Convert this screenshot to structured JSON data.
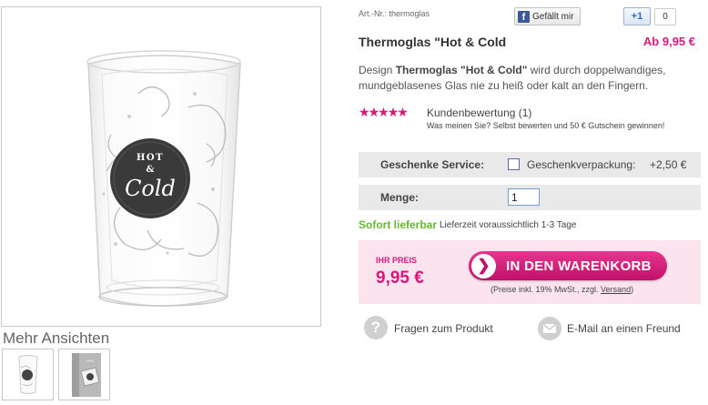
{
  "gallery": {
    "main_image": {
      "alt": "Thermoglas Hot & Cold",
      "badge_line1": "HOT",
      "badge_line2": "&",
      "badge_line3": "Cold"
    },
    "more_views_title": "Mehr Ansichten",
    "thumbnails": [
      "thumb-1",
      "thumb-2"
    ]
  },
  "product": {
    "art_nr": "Art.-Nr.: thermoglas",
    "title": "Thermoglas \"Hot & Cold",
    "price_from": "Ab 9,95 €",
    "description_prefix": "Design ",
    "description_bold": "Thermoglas \"Hot & Cold\"",
    "description_suffix": " wird durch doppelwandiges, mundgeblasenes Glas nie zu heiß oder kalt an den Fingern."
  },
  "social": {
    "fb_label": "Gefällt mir",
    "gplus_label": "+1",
    "gplus_count": "0"
  },
  "rating": {
    "stars": 5,
    "max": 5,
    "link": "Kundenbewertung (1)",
    "note": "Was meinen Sie? Selbst bewerten und 50 € Gutschein gewinnen!"
  },
  "options": {
    "gift_label": "Geschenke Service:",
    "gift_option": "Geschenkverpackung:",
    "gift_price": "+2,50 €",
    "gift_checked": false,
    "qty_label": "Menge:",
    "qty_value": "1"
  },
  "shipping": {
    "availability": "Sofort lieferbar",
    "delivery_time": "Lieferzeit voraussichtlich 1-3 Tage"
  },
  "cart": {
    "your_price_label": "IHR PREIS",
    "your_price": "9,95 €",
    "button_label": "IN DEN WARENKORB",
    "price_note_prefix": "(Preise inkl. 19% MwSt., zzgl. ",
    "price_note_link": "Versand",
    "price_note_suffix": ")"
  },
  "actions": {
    "question_label": "Fragen zum Produkt",
    "email_label": "E-Mail an einen Freund"
  },
  "colors": {
    "accent": "#d61a7c",
    "available": "#67b82e",
    "cart_bg": "#fbe4ee",
    "row_bg": "#e9e9e9"
  },
  "icons": {
    "fb": "facebook-icon",
    "gplus": "google-plus-icon",
    "star": "star-icon",
    "cart_arrow": "arrow-right-icon",
    "question": "question-icon",
    "mail": "mail-icon"
  }
}
